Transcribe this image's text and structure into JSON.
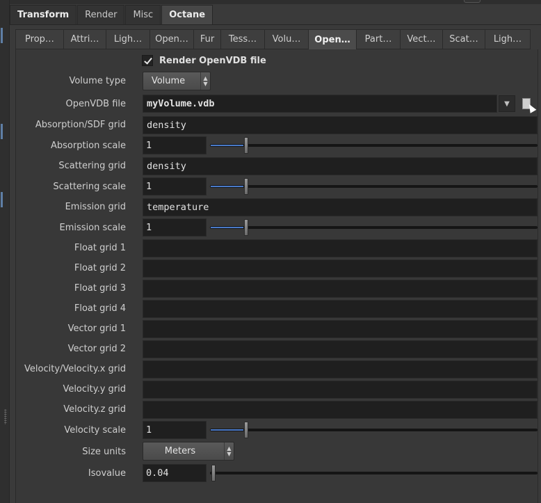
{
  "main_tabs": [
    {
      "label": "Transform",
      "bold": true,
      "active": false
    },
    {
      "label": "Render",
      "bold": false,
      "active": false
    },
    {
      "label": "Misc",
      "bold": false,
      "active": false
    },
    {
      "label": "Octane",
      "bold": true,
      "active": true
    }
  ],
  "sub_tabs": [
    {
      "label": "Prop…",
      "active": false
    },
    {
      "label": "Attri…",
      "active": false
    },
    {
      "label": "Ligh…",
      "active": false
    },
    {
      "label": "Open…",
      "active": false
    },
    {
      "label": "Fur",
      "active": false
    },
    {
      "label": "Tess…",
      "active": false
    },
    {
      "label": "Volu…",
      "active": false
    },
    {
      "label": "Open…",
      "active": true
    },
    {
      "label": "Part…",
      "active": false
    },
    {
      "label": "Vect…",
      "active": false
    },
    {
      "label": "Scat…",
      "active": false
    },
    {
      "label": "Ligh…",
      "active": false
    }
  ],
  "render_openvdb": {
    "label": "Render OpenVDB file",
    "checked": true
  },
  "volume_type": {
    "label": "Volume type",
    "value": "Volume"
  },
  "openvdb_file": {
    "label": "OpenVDB file",
    "value": "myVolume.vdb"
  },
  "absorption_grid": {
    "label": "Absorption/SDF grid",
    "value": "density"
  },
  "absorption_scale": {
    "label": "Absorption scale",
    "value": "1",
    "slider_fraction": 0.1
  },
  "scattering_grid": {
    "label": "Scattering grid",
    "value": "density"
  },
  "scattering_scale": {
    "label": "Scattering scale",
    "value": "1",
    "slider_fraction": 0.1
  },
  "emission_grid": {
    "label": "Emission grid",
    "value": "temperature"
  },
  "emission_scale": {
    "label": "Emission scale",
    "value": "1",
    "slider_fraction": 0.1
  },
  "float_grid_1": {
    "label": "Float grid 1",
    "value": ""
  },
  "float_grid_2": {
    "label": "Float grid 2",
    "value": ""
  },
  "float_grid_3": {
    "label": "Float grid 3",
    "value": ""
  },
  "float_grid_4": {
    "label": "Float grid 4",
    "value": ""
  },
  "vector_grid_1": {
    "label": "Vector grid 1",
    "value": ""
  },
  "vector_grid_2": {
    "label": "Vector grid 2",
    "value": ""
  },
  "velocity_x_grid": {
    "label": "Velocity/Velocity.x grid",
    "value": ""
  },
  "velocity_y_grid": {
    "label": "Velocity.y grid",
    "value": ""
  },
  "velocity_z_grid": {
    "label": "Velocity.z grid",
    "value": ""
  },
  "velocity_scale": {
    "label": "Velocity scale",
    "value": "1",
    "slider_fraction": 0.1
  },
  "size_units": {
    "label": "Size units",
    "value": "Meters"
  },
  "isovalue": {
    "label": "Isovalue",
    "value": "0.04",
    "slider_fraction": 0.0
  },
  "colors": {
    "accent": "#4a7ac8",
    "panel": "#383838",
    "field": "#1f1f1f"
  }
}
